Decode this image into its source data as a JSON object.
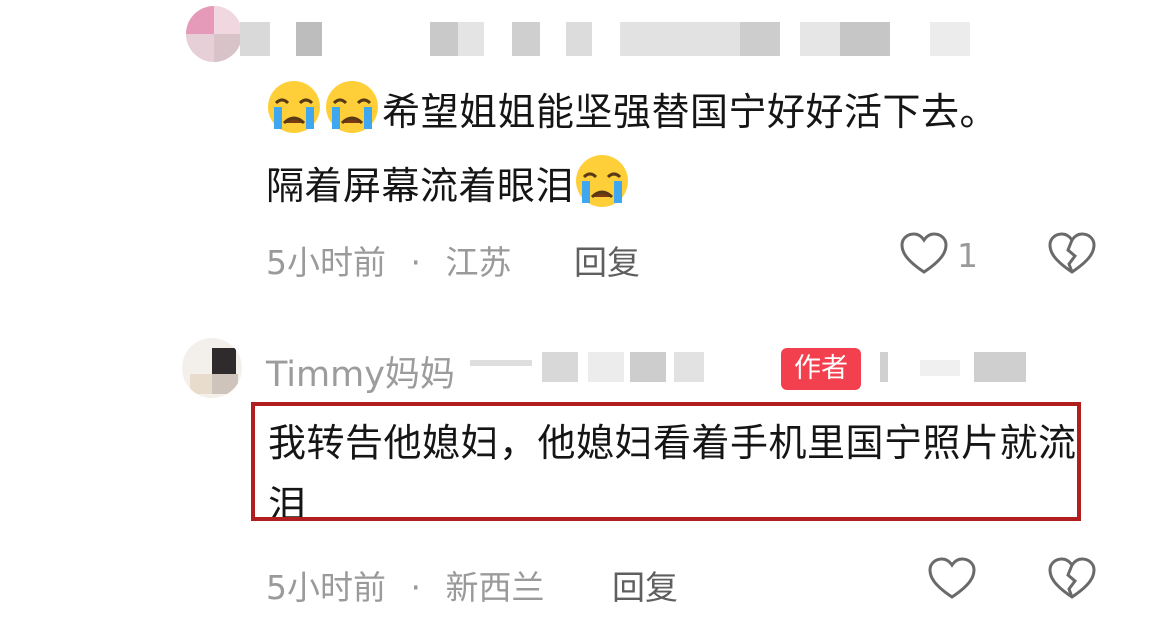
{
  "comments": [
    {
      "text_line1": "希望姐姐能坚强替国宁好好活下去。",
      "text_line2": "隔着屏幕流着眼泪",
      "time": "5小时前",
      "separator": "·",
      "location": "江苏",
      "reply_label": "回复",
      "like_count": "1"
    },
    {
      "username": "Timmy妈妈",
      "author_badge": "作者",
      "text": "我转告他媳妇，他媳妇看着手机里国宁照片就流泪",
      "time": "5小时前",
      "separator": "·",
      "location": "新西兰",
      "reply_label": "回复"
    }
  ],
  "colors": {
    "badge_bg": "#f2404f",
    "highlight_border": "#b01e1e",
    "meta_gray": "#9a9a9a"
  },
  "icons": [
    "crying-emoji-icon",
    "heart-icon",
    "broken-heart-icon"
  ]
}
